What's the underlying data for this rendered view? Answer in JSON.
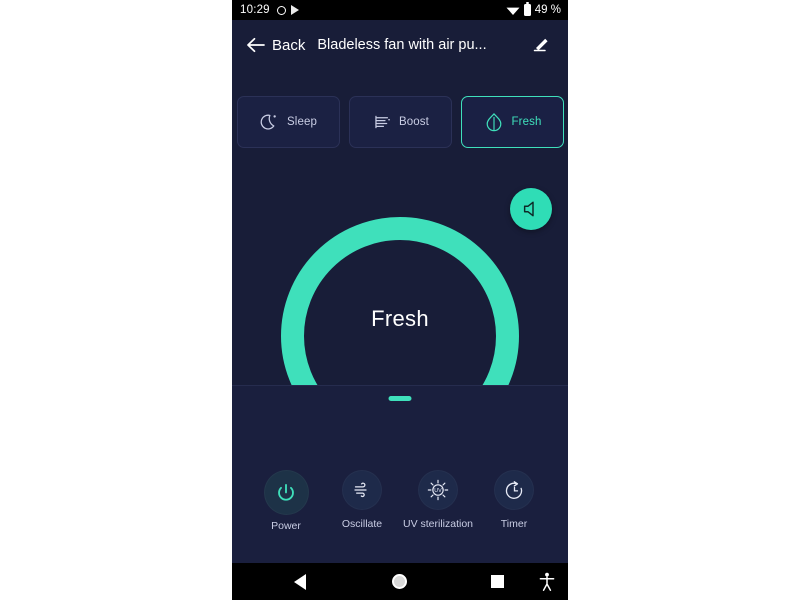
{
  "colors": {
    "phone_bg": "#181d38",
    "panel_bg": "#1a1f3e",
    "accent": "#3fe0bb",
    "accent_solid": "#2fddb6",
    "ring_track": "#181d38",
    "text_primary": "#ffffff",
    "text_secondary": "#c9cde4",
    "card_border": "#2b3157",
    "card_bg": "#1b2143",
    "navbar_bg": "#000000"
  },
  "statusbar": {
    "time": "10:29",
    "battery_percent": "49 %",
    "icons": [
      "circle-outline-icon",
      "play-store-icon",
      "wifi-icon",
      "battery-icon"
    ]
  },
  "appbar": {
    "back_icon": "arrow-left-icon",
    "back_label": "Back",
    "device_title": "Bladeless fan with air pu...",
    "edit_icon": "pencil-edit-icon"
  },
  "modes": {
    "items": [
      {
        "label": "Sleep",
        "icon": "moon-icon",
        "active": false
      },
      {
        "label": "Boost",
        "icon": "wind-lines-icon",
        "active": false
      },
      {
        "label": "Fresh",
        "icon": "leaf-icon",
        "active": true
      }
    ]
  },
  "dial": {
    "center_label": "Fresh",
    "sound_button_icon": "speaker-mute-icon",
    "arc_sweep_degrees": 280,
    "arc_value_degrees": 280
  },
  "sheet": {
    "handle_label": "drag-handle"
  },
  "controls": {
    "items": [
      {
        "label": "Power",
        "icon": "power-icon"
      },
      {
        "label": "Oscillate",
        "icon": "wind-oscillate-icon"
      },
      {
        "label": "UV sterilization",
        "icon": "uv-sun-icon"
      },
      {
        "label": "Timer",
        "icon": "timer-clock-icon"
      }
    ]
  },
  "navbar": {
    "items": [
      "nav-back-triangle-icon",
      "nav-home-circle-icon",
      "nav-recents-square-icon",
      "accessibility-icon"
    ]
  }
}
